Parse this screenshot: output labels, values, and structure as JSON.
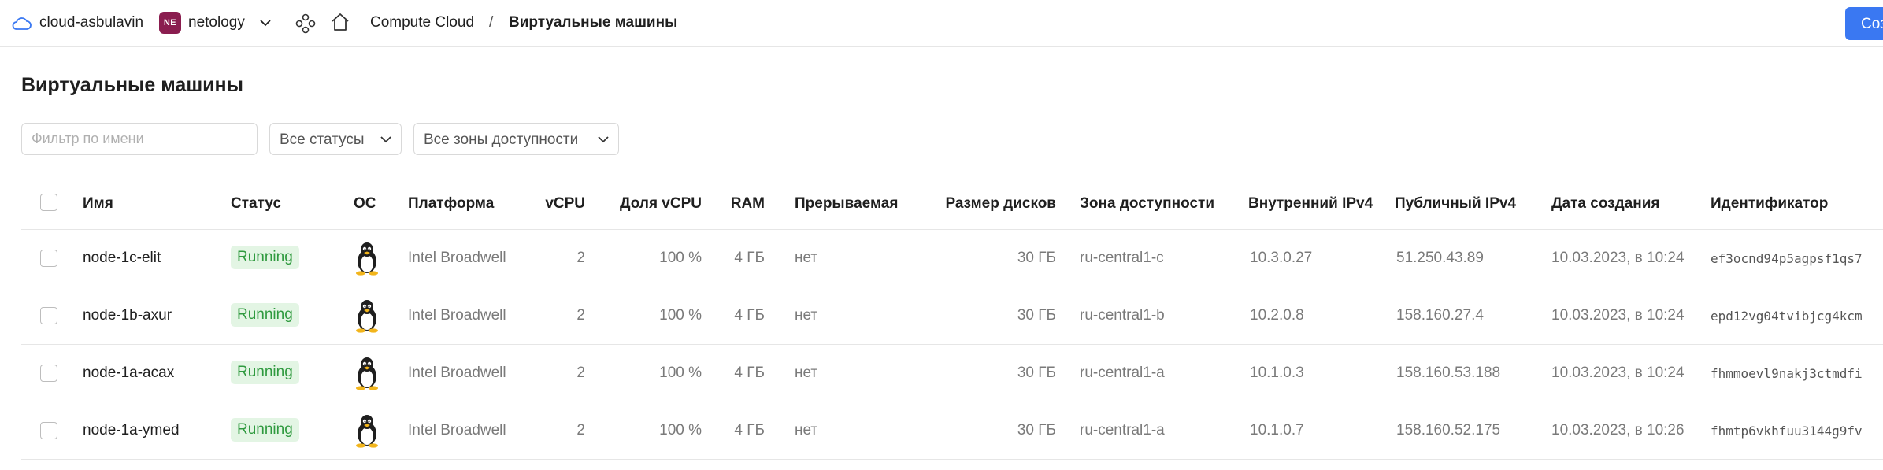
{
  "topbar": {
    "cloud_name": "cloud-asbulavin",
    "org_badge": "NE",
    "org_name": "netology",
    "breadcrumb_service": "Compute Cloud",
    "breadcrumb_separator": "/",
    "breadcrumb_current": "Виртуальные машины",
    "create_label": "Соз",
    "org_badge_color": "#8a1d4f",
    "create_color": "#3a78f2"
  },
  "page": {
    "title": "Виртуальные машины"
  },
  "filters": {
    "name_placeholder": "Фильтр по имени",
    "name_value": "",
    "status_selected": "Все статусы",
    "zone_selected": "Все зоны доступности"
  },
  "table": {
    "columns": {
      "name": "Имя",
      "status": "Статус",
      "os": "ОС",
      "platform": "Платформа",
      "vcpu": "vCPU",
      "vcpu_share": "Доля vCPU",
      "ram": "RAM",
      "preemptible": "Прерываемая",
      "disk_size": "Размер дисков",
      "zone": "Зона доступности",
      "internal_ipv4": "Внутренний IPv4",
      "public_ipv4": "Публичный IPv4",
      "created": "Дата создания",
      "id": "Идентификатор"
    },
    "rows": [
      {
        "name": "node-1c-elit",
        "status": "Running",
        "os_icon": "linux-tux-icon",
        "platform": "Intel Broadwell",
        "vcpu": "2",
        "vcpu_share": "100 %",
        "ram": "4 ГБ",
        "preemptible": "нет",
        "disk_size": "30 ГБ",
        "zone": "ru-central1-c",
        "internal_ipv4": "10.3.0.27",
        "public_ipv4": "51.250.43.89",
        "created": "10.03.2023, в 10:24",
        "id": "ef3ocnd94p5agpsf1qs7"
      },
      {
        "name": "node-1b-axur",
        "status": "Running",
        "os_icon": "linux-tux-icon",
        "platform": "Intel Broadwell",
        "vcpu": "2",
        "vcpu_share": "100 %",
        "ram": "4 ГБ",
        "preemptible": "нет",
        "disk_size": "30 ГБ",
        "zone": "ru-central1-b",
        "internal_ipv4": "10.2.0.8",
        "public_ipv4": "158.160.27.4",
        "created": "10.03.2023, в 10:24",
        "id": "epd12vg04tvibjcg4kcm"
      },
      {
        "name": "node-1a-acax",
        "status": "Running",
        "os_icon": "linux-tux-icon",
        "platform": "Intel Broadwell",
        "vcpu": "2",
        "vcpu_share": "100 %",
        "ram": "4 ГБ",
        "preemptible": "нет",
        "disk_size": "30 ГБ",
        "zone": "ru-central1-a",
        "internal_ipv4": "10.1.0.3",
        "public_ipv4": "158.160.53.188",
        "created": "10.03.2023, в 10:24",
        "id": "fhmmoevl9nakj3ctmdfi"
      },
      {
        "name": "node-1a-ymed",
        "status": "Running",
        "os_icon": "linux-tux-icon",
        "platform": "Intel Broadwell",
        "vcpu": "2",
        "vcpu_share": "100 %",
        "ram": "4 ГБ",
        "preemptible": "нет",
        "disk_size": "30 ГБ",
        "zone": "ru-central1-a",
        "internal_ipv4": "10.1.0.7",
        "public_ipv4": "158.160.52.175",
        "created": "10.03.2023, в 10:26",
        "id": "fhmtp6vkhfuu3144g9fv"
      }
    ],
    "status_colors": {
      "running_bg": "#e3f5e4",
      "running_text": "#2f9a3f"
    }
  }
}
